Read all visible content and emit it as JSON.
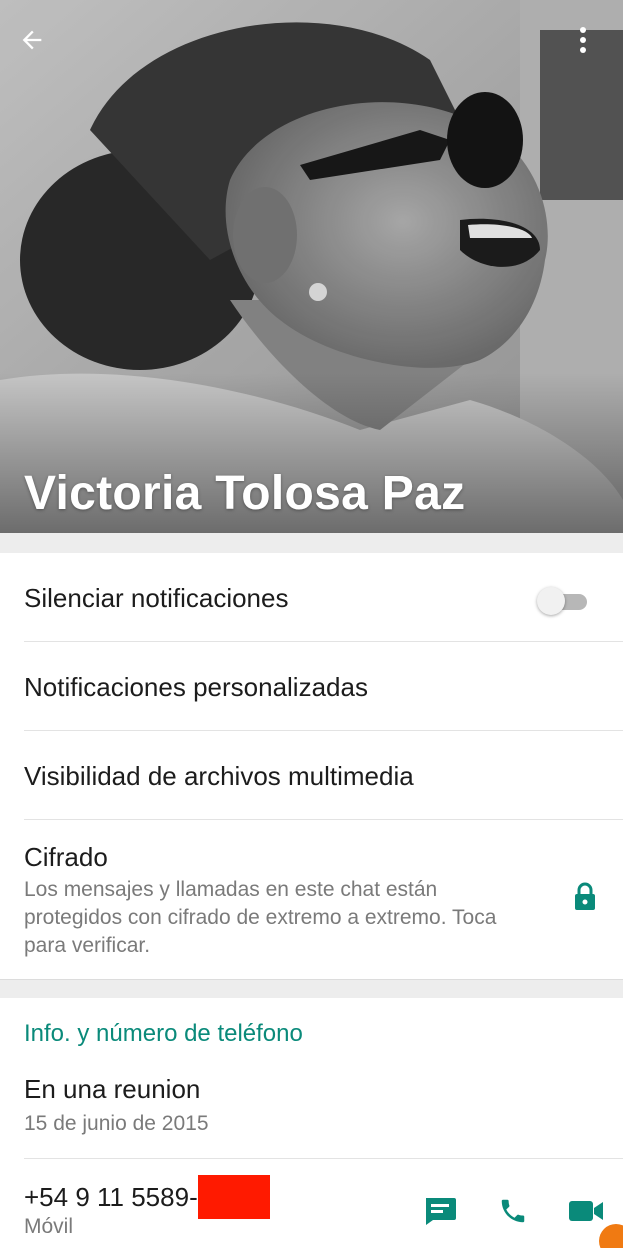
{
  "header": {
    "contact_name": "Victoria Tolosa Paz",
    "back_icon": "arrow-left-icon",
    "menu_icon": "more-vertical-icon"
  },
  "settings": {
    "mute_label": "Silenciar notificaciones",
    "mute_enabled": false,
    "custom_notifications_label": "Notificaciones personalizadas",
    "media_visibility_label": "Visibilidad de archivos multimedia",
    "encryption": {
      "title": "Cifrado",
      "description": "Los mensajes y llamadas en este chat están protegidos con cifrado de extremo a extremo. Toca para verificar.",
      "icon": "lock-icon"
    }
  },
  "info": {
    "section_title": "Info. y número de teléfono",
    "about_text": "En una reunion",
    "about_date": "15 de junio de 2015",
    "phone_number": "+54 9 11 5589-",
    "phone_type": "Móvil",
    "actions": [
      {
        "name": "message-icon"
      },
      {
        "name": "phone-call-icon"
      },
      {
        "name": "video-call-icon"
      }
    ]
  },
  "colors": {
    "accent": "#0a8a7a",
    "redaction": "#ff1a00",
    "background": "#ededed"
  }
}
